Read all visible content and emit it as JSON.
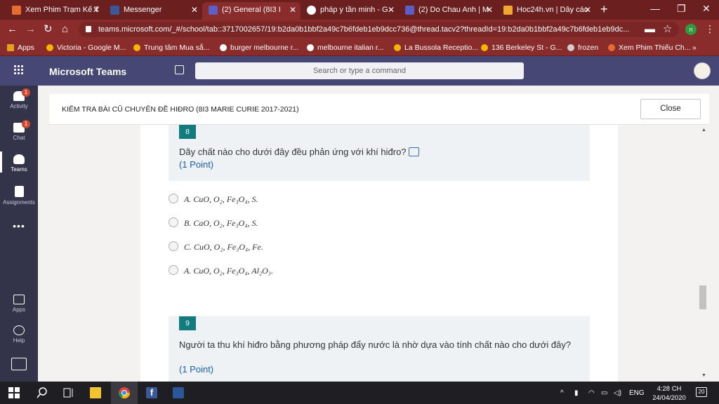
{
  "browser": {
    "tabs": [
      {
        "title": "Xem Phim Trạm Kế T",
        "icon": "play-icon",
        "color": "#e66b2e"
      },
      {
        "title": "Messenger",
        "icon": "facebook-icon",
        "color": "#3b5998"
      },
      {
        "title": "(2) General (8I3 I",
        "icon": "teams-icon",
        "color": "#5b5fc7",
        "active": true
      },
      {
        "title": "pháp y tần minh - G",
        "icon": "google-icon",
        "color": "#ffffff"
      },
      {
        "title": "(2) Do Chau Anh | M",
        "icon": "teams-icon",
        "color": "#5b5fc7"
      },
      {
        "title": "Hoc24h.vn | Dây các",
        "icon": "hoc24h-icon",
        "color": "#f2a72f"
      }
    ],
    "url": "teams.microsoft.com/_#/school/tab::3717002657/19:b2da0b1bbf2a49c7b6fdeb1eb9dcc736@thread.tacv2?threadId=19:b2da0b1bbf2a49c7b6fdeb1eb9dc...",
    "profile_initial": "n",
    "bookmarks": [
      {
        "label": "Apps",
        "color": "#e3a21a"
      },
      {
        "label": "Victoria - Google M...",
        "color": "#f4b400"
      },
      {
        "label": "Trung tâm Mua sắ...",
        "color": "#f4b400"
      },
      {
        "label": "burger melbourne r...",
        "color": "#ffffff"
      },
      {
        "label": "melbourne italian r...",
        "color": "#ffffff"
      },
      {
        "label": "La Bussola Receptio...",
        "color": "#f4b400"
      },
      {
        "label": "136 Berkeley St - G...",
        "color": "#f4b400"
      },
      {
        "label": "frozen",
        "color": "#cfcfcf"
      },
      {
        "label": "Xem Phim Thiếu Ch...",
        "color": "#e66b2e"
      }
    ],
    "bookmarks_more": "»"
  },
  "teams": {
    "title": "Microsoft Teams",
    "search_placeholder": "Search or type a command",
    "accent": "#464775",
    "rail": [
      {
        "label": "Activity",
        "badge": "1",
        "icon": "bell-icon"
      },
      {
        "label": "Chat",
        "badge": "1",
        "icon": "chat-icon"
      },
      {
        "label": "Teams",
        "badge": "",
        "icon": "teams-icon",
        "active": true
      },
      {
        "label": "Assignments",
        "badge": "",
        "icon": "assignments-icon"
      },
      {
        "label": "Apps",
        "badge": "",
        "icon": "apps-icon"
      },
      {
        "label": "Help",
        "badge": "",
        "icon": "help-icon"
      }
    ],
    "more_label": "•••"
  },
  "form": {
    "title": "KIỂM TRA BÀI CŨ CHUYÊN ĐỀ HIĐRO (8I3 MARIE CURIE 2017-2021)",
    "close_label": "Close",
    "questions": [
      {
        "number": "8",
        "text": "Dãy chất nào cho dưới đây đều phản ứng với khí hiđro?",
        "points": "(1 Point)",
        "options": [
          "A. CuO, O₂, Fe₃O₄, S.",
          "B. CaO, O₂, Fe₃O₄, S.",
          "C. CuO, O₂, Fe₃O₄, Fe.",
          "A. CuO, O₂, Fe₃O₄, Al₂O₃."
        ]
      },
      {
        "number": "9",
        "text": "Người ta thu khí hiđro bằng phương pháp đẩy nước là nhờ dựa vào tính chất nào cho dưới đây?",
        "points": "(1 Point)"
      }
    ]
  },
  "taskbar": {
    "language": "ENG",
    "time": "4:28 CH",
    "date": "24/04/2020",
    "notifications": "20"
  }
}
